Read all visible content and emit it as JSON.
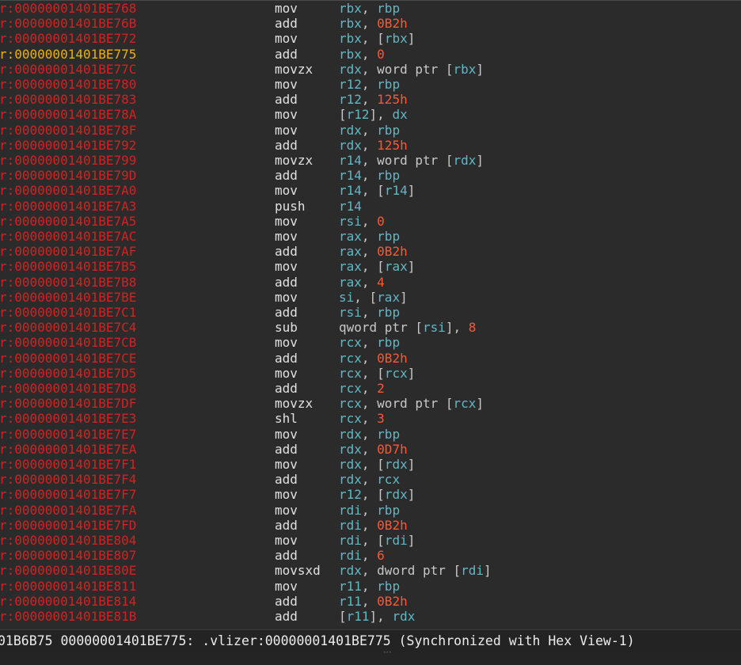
{
  "disasm": {
    "rows": [
      {
        "addr": "r:00000001401BE768",
        "mnem": "mov",
        "ops": [
          [
            "reg",
            "rbx"
          ],
          [
            "pn",
            ", "
          ],
          [
            "reg",
            "rbp"
          ]
        ]
      },
      {
        "addr": "r:00000001401BE76B",
        "mnem": "add",
        "ops": [
          [
            "reg",
            "rbx"
          ],
          [
            "pn",
            ", "
          ],
          [
            "imm",
            "0B2h"
          ]
        ]
      },
      {
        "addr": "r:00000001401BE772",
        "mnem": "mov",
        "ops": [
          [
            "reg",
            "rbx"
          ],
          [
            "pn",
            ", ["
          ],
          [
            "reg",
            "rbx"
          ],
          [
            "pn",
            "]"
          ]
        ]
      },
      {
        "addr": "r:00000001401BE775",
        "mnem": "add",
        "ops": [
          [
            "reg",
            "rbx"
          ],
          [
            "pn",
            ", "
          ],
          [
            "imm",
            "0"
          ]
        ],
        "current": true
      },
      {
        "addr": "r:00000001401BE77C",
        "mnem": "movzx",
        "ops": [
          [
            "reg",
            "rdx"
          ],
          [
            "pn",
            ", "
          ],
          [
            "kw",
            "word ptr "
          ],
          [
            "pn",
            "["
          ],
          [
            "reg",
            "rbx"
          ],
          [
            "pn",
            "]"
          ]
        ]
      },
      {
        "addr": "r:00000001401BE780",
        "mnem": "mov",
        "ops": [
          [
            "reg",
            "r12"
          ],
          [
            "pn",
            ", "
          ],
          [
            "reg",
            "rbp"
          ]
        ]
      },
      {
        "addr": "r:00000001401BE783",
        "mnem": "add",
        "ops": [
          [
            "reg",
            "r12"
          ],
          [
            "pn",
            ", "
          ],
          [
            "imm",
            "125h"
          ]
        ]
      },
      {
        "addr": "r:00000001401BE78A",
        "mnem": "mov",
        "ops": [
          [
            "pn",
            "["
          ],
          [
            "reg",
            "r12"
          ],
          [
            "pn",
            "], "
          ],
          [
            "reg",
            "dx"
          ]
        ]
      },
      {
        "addr": "r:00000001401BE78F",
        "mnem": "mov",
        "ops": [
          [
            "reg",
            "rdx"
          ],
          [
            "pn",
            ", "
          ],
          [
            "reg",
            "rbp"
          ]
        ]
      },
      {
        "addr": "r:00000001401BE792",
        "mnem": "add",
        "ops": [
          [
            "reg",
            "rdx"
          ],
          [
            "pn",
            ", "
          ],
          [
            "imm",
            "125h"
          ]
        ]
      },
      {
        "addr": "r:00000001401BE799",
        "mnem": "movzx",
        "ops": [
          [
            "reg",
            "r14"
          ],
          [
            "pn",
            ", "
          ],
          [
            "kw",
            "word ptr "
          ],
          [
            "pn",
            "["
          ],
          [
            "reg",
            "rdx"
          ],
          [
            "pn",
            "]"
          ]
        ]
      },
      {
        "addr": "r:00000001401BE79D",
        "mnem": "add",
        "ops": [
          [
            "reg",
            "r14"
          ],
          [
            "pn",
            ", "
          ],
          [
            "reg",
            "rbp"
          ]
        ]
      },
      {
        "addr": "r:00000001401BE7A0",
        "mnem": "mov",
        "ops": [
          [
            "reg",
            "r14"
          ],
          [
            "pn",
            ", ["
          ],
          [
            "reg",
            "r14"
          ],
          [
            "pn",
            "]"
          ]
        ]
      },
      {
        "addr": "r:00000001401BE7A3",
        "mnem": "push",
        "ops": [
          [
            "reg",
            "r14"
          ]
        ]
      },
      {
        "addr": "r:00000001401BE7A5",
        "mnem": "mov",
        "ops": [
          [
            "reg",
            "rsi"
          ],
          [
            "pn",
            ", "
          ],
          [
            "imm",
            "0"
          ]
        ]
      },
      {
        "addr": "r:00000001401BE7AC",
        "mnem": "mov",
        "ops": [
          [
            "reg",
            "rax"
          ],
          [
            "pn",
            ", "
          ],
          [
            "reg",
            "rbp"
          ]
        ]
      },
      {
        "addr": "r:00000001401BE7AF",
        "mnem": "add",
        "ops": [
          [
            "reg",
            "rax"
          ],
          [
            "pn",
            ", "
          ],
          [
            "imm",
            "0B2h"
          ]
        ]
      },
      {
        "addr": "r:00000001401BE7B5",
        "mnem": "mov",
        "ops": [
          [
            "reg",
            "rax"
          ],
          [
            "pn",
            ", ["
          ],
          [
            "reg",
            "rax"
          ],
          [
            "pn",
            "]"
          ]
        ]
      },
      {
        "addr": "r:00000001401BE7B8",
        "mnem": "add",
        "ops": [
          [
            "reg",
            "rax"
          ],
          [
            "pn",
            ", "
          ],
          [
            "imm",
            "4"
          ]
        ]
      },
      {
        "addr": "r:00000001401BE7BE",
        "mnem": "mov",
        "ops": [
          [
            "reg",
            "si"
          ],
          [
            "pn",
            ", ["
          ],
          [
            "reg",
            "rax"
          ],
          [
            "pn",
            "]"
          ]
        ]
      },
      {
        "addr": "r:00000001401BE7C1",
        "mnem": "add",
        "ops": [
          [
            "reg",
            "rsi"
          ],
          [
            "pn",
            ", "
          ],
          [
            "reg",
            "rbp"
          ]
        ]
      },
      {
        "addr": "r:00000001401BE7C4",
        "mnem": "sub",
        "ops": [
          [
            "kw",
            "qword ptr "
          ],
          [
            "pn",
            "["
          ],
          [
            "reg",
            "rsi"
          ],
          [
            "pn",
            "], "
          ],
          [
            "imm",
            "8"
          ]
        ]
      },
      {
        "addr": "r:00000001401BE7CB",
        "mnem": "mov",
        "ops": [
          [
            "reg",
            "rcx"
          ],
          [
            "pn",
            ", "
          ],
          [
            "reg",
            "rbp"
          ]
        ]
      },
      {
        "addr": "r:00000001401BE7CE",
        "mnem": "add",
        "ops": [
          [
            "reg",
            "rcx"
          ],
          [
            "pn",
            ", "
          ],
          [
            "imm",
            "0B2h"
          ]
        ]
      },
      {
        "addr": "r:00000001401BE7D5",
        "mnem": "mov",
        "ops": [
          [
            "reg",
            "rcx"
          ],
          [
            "pn",
            ", ["
          ],
          [
            "reg",
            "rcx"
          ],
          [
            "pn",
            "]"
          ]
        ]
      },
      {
        "addr": "r:00000001401BE7D8",
        "mnem": "add",
        "ops": [
          [
            "reg",
            "rcx"
          ],
          [
            "pn",
            ", "
          ],
          [
            "imm",
            "2"
          ]
        ]
      },
      {
        "addr": "r:00000001401BE7DF",
        "mnem": "movzx",
        "ops": [
          [
            "reg",
            "rcx"
          ],
          [
            "pn",
            ", "
          ],
          [
            "kw",
            "word ptr "
          ],
          [
            "pn",
            "["
          ],
          [
            "reg",
            "rcx"
          ],
          [
            "pn",
            "]"
          ]
        ]
      },
      {
        "addr": "r:00000001401BE7E3",
        "mnem": "shl",
        "ops": [
          [
            "reg",
            "rcx"
          ],
          [
            "pn",
            ", "
          ],
          [
            "imm",
            "3"
          ]
        ]
      },
      {
        "addr": "r:00000001401BE7E7",
        "mnem": "mov",
        "ops": [
          [
            "reg",
            "rdx"
          ],
          [
            "pn",
            ", "
          ],
          [
            "reg",
            "rbp"
          ]
        ]
      },
      {
        "addr": "r:00000001401BE7EA",
        "mnem": "add",
        "ops": [
          [
            "reg",
            "rdx"
          ],
          [
            "pn",
            ", "
          ],
          [
            "imm",
            "0D7h"
          ]
        ]
      },
      {
        "addr": "r:00000001401BE7F1",
        "mnem": "mov",
        "ops": [
          [
            "reg",
            "rdx"
          ],
          [
            "pn",
            ", ["
          ],
          [
            "reg",
            "rdx"
          ],
          [
            "pn",
            "]"
          ]
        ]
      },
      {
        "addr": "r:00000001401BE7F4",
        "mnem": "add",
        "ops": [
          [
            "reg",
            "rdx"
          ],
          [
            "pn",
            ", "
          ],
          [
            "reg",
            "rcx"
          ]
        ]
      },
      {
        "addr": "r:00000001401BE7F7",
        "mnem": "mov",
        "ops": [
          [
            "reg",
            "r12"
          ],
          [
            "pn",
            ", ["
          ],
          [
            "reg",
            "rdx"
          ],
          [
            "pn",
            "]"
          ]
        ]
      },
      {
        "addr": "r:00000001401BE7FA",
        "mnem": "mov",
        "ops": [
          [
            "reg",
            "rdi"
          ],
          [
            "pn",
            ", "
          ],
          [
            "reg",
            "rbp"
          ]
        ]
      },
      {
        "addr": "r:00000001401BE7FD",
        "mnem": "add",
        "ops": [
          [
            "reg",
            "rdi"
          ],
          [
            "pn",
            ", "
          ],
          [
            "imm",
            "0B2h"
          ]
        ]
      },
      {
        "addr": "r:00000001401BE804",
        "mnem": "mov",
        "ops": [
          [
            "reg",
            "rdi"
          ],
          [
            "pn",
            ", ["
          ],
          [
            "reg",
            "rdi"
          ],
          [
            "pn",
            "]"
          ]
        ]
      },
      {
        "addr": "r:00000001401BE807",
        "mnem": "add",
        "ops": [
          [
            "reg",
            "rdi"
          ],
          [
            "pn",
            ", "
          ],
          [
            "imm",
            "6"
          ]
        ]
      },
      {
        "addr": "r:00000001401BE80E",
        "mnem": "movsxd",
        "ops": [
          [
            "reg",
            "rdx"
          ],
          [
            "pn",
            ", "
          ],
          [
            "kw",
            "dword ptr "
          ],
          [
            "pn",
            "["
          ],
          [
            "reg",
            "rdi"
          ],
          [
            "pn",
            "]"
          ]
        ]
      },
      {
        "addr": "r:00000001401BE811",
        "mnem": "mov",
        "ops": [
          [
            "reg",
            "r11"
          ],
          [
            "pn",
            ", "
          ],
          [
            "reg",
            "rbp"
          ]
        ]
      },
      {
        "addr": "r:00000001401BE814",
        "mnem": "add",
        "ops": [
          [
            "reg",
            "r11"
          ],
          [
            "pn",
            ", "
          ],
          [
            "imm",
            "0B2h"
          ]
        ]
      },
      {
        "addr": "r:00000001401BE81B",
        "mnem": "add",
        "ops": [
          [
            "pn",
            "["
          ],
          [
            "reg",
            "r11"
          ],
          [
            "pn",
            "], "
          ],
          [
            "reg",
            "rdx"
          ]
        ]
      }
    ]
  },
  "status_bar": {
    "text": "01B6B75 00000001401BE775: .vlizer:00000001401BE775 (Synchronized with Hex View-1)"
  },
  "colors": {
    "background": "#2b2b2b",
    "address": "#d22222",
    "address_current": "#f0b000",
    "mnemonic": "#e0e0e0",
    "register": "#5fb8c5",
    "immediate": "#ff5733",
    "status_bar_background": "#232323"
  },
  "icons": {
    "splitter": "splitter-grip-icon"
  }
}
